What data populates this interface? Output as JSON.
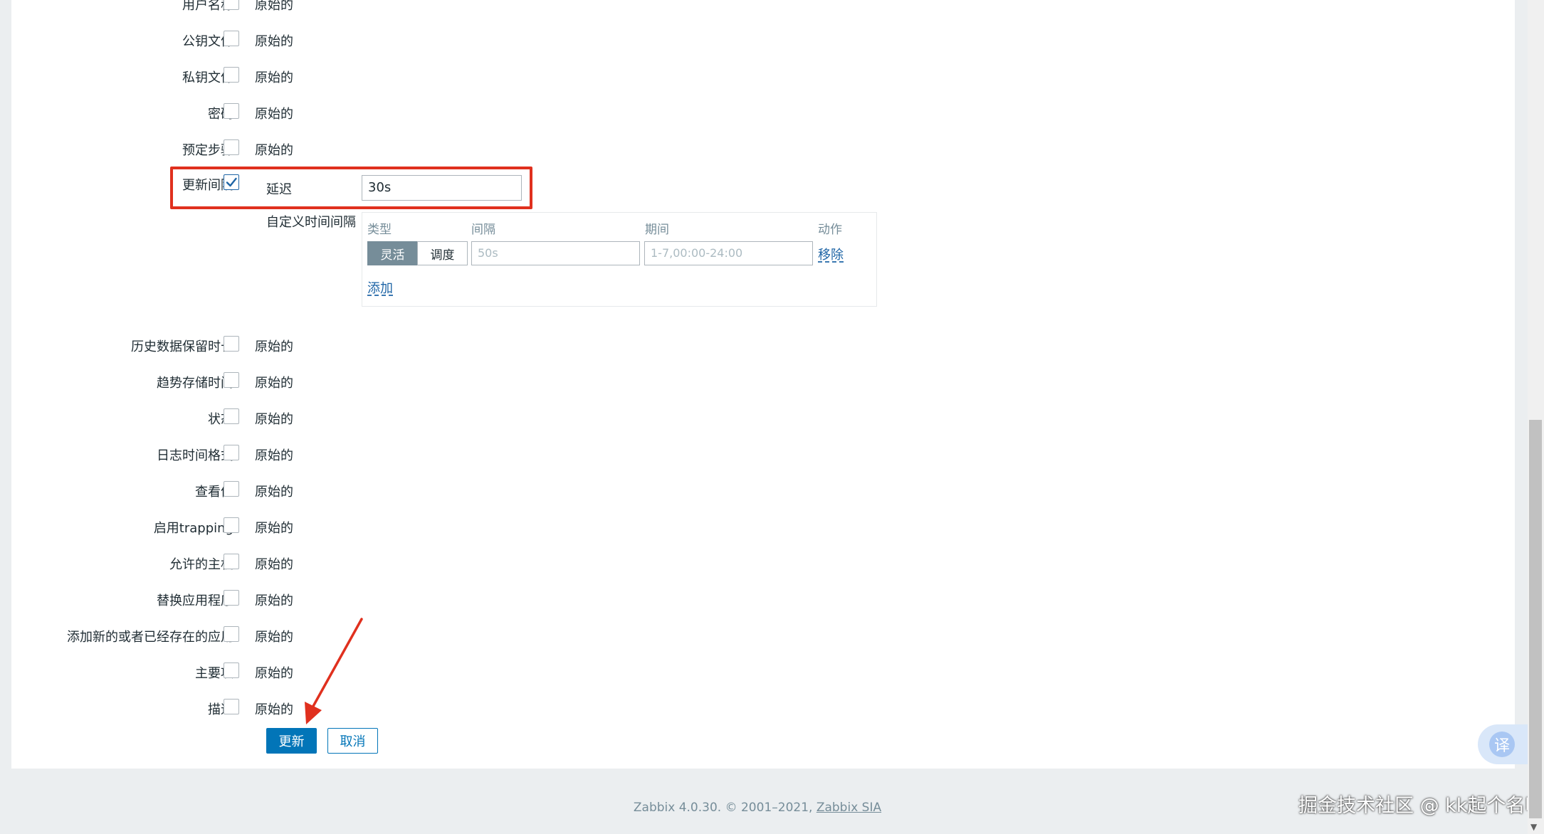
{
  "form": {
    "rows_top": [
      {
        "label": "用户名称",
        "value": "原始的"
      },
      {
        "label": "公钥文件",
        "value": "原始的"
      },
      {
        "label": "私钥文件",
        "value": "原始的"
      },
      {
        "label": "密码",
        "value": "原始的"
      },
      {
        "label": "预定步骤",
        "value": "原始的"
      }
    ],
    "update_interval": {
      "label": "更新间隔",
      "checked": true,
      "delay_label": "延迟",
      "delay_value": "30s",
      "custom_label": "自定义时间间隔",
      "columns": {
        "type": "类型",
        "interval": "间隔",
        "period": "期间",
        "action": "动作"
      },
      "type_options": {
        "flexible": "灵活",
        "scheduling": "调度"
      },
      "interval_placeholder": "50s",
      "period_placeholder": "1-7,00:00-24:00",
      "remove_link": "移除",
      "add_link": "添加"
    },
    "rows_bottom": [
      {
        "label": "历史数据保留时长",
        "value": "原始的"
      },
      {
        "label": "趋势存储时间",
        "value": "原始的"
      },
      {
        "label": "状态",
        "value": "原始的"
      },
      {
        "label": "日志时间格式",
        "value": "原始的"
      },
      {
        "label": "查看值",
        "value": "原始的"
      },
      {
        "label": "启用trapping",
        "value": "原始的"
      },
      {
        "label": "允许的主机",
        "value": "原始的"
      },
      {
        "label": "替换应用程序",
        "value": "原始的"
      },
      {
        "label": "添加新的或者已经存在的应用",
        "value": "原始的"
      },
      {
        "label": "主要项",
        "value": "原始的"
      },
      {
        "label": "描述",
        "value": "原始的"
      }
    ],
    "buttons": {
      "update": "更新",
      "cancel": "取消"
    }
  },
  "footer": {
    "text": "Zabbix 4.0.30. © 2001–2021, ",
    "link": "Zabbix SIA"
  },
  "translate_button": "译",
  "watermark": "掘金技术社区 @ kk起个名吧",
  "colors": {
    "accent": "#0275b8",
    "highlight_box": "#e0301e",
    "link": "#1f65a6"
  }
}
